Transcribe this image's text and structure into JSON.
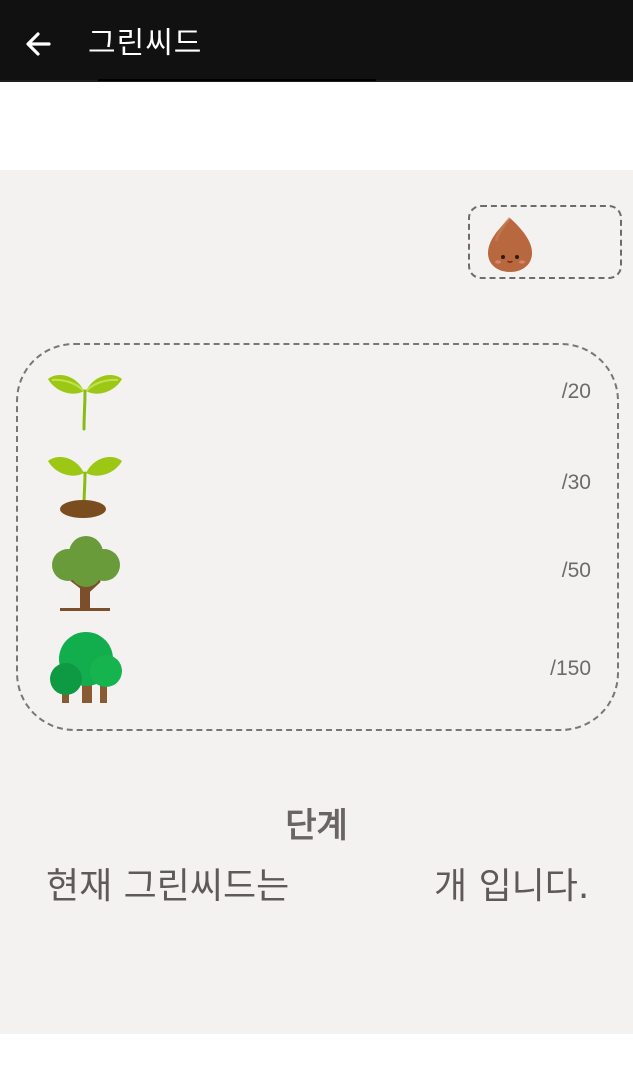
{
  "appbar": {
    "title": "그린씨드",
    "back_icon": "arrow-left-icon"
  },
  "seed": {
    "icon": "seed-character-icon"
  },
  "stages": [
    {
      "icon": "sprout-icon",
      "current": "",
      "max_label": "/20"
    },
    {
      "icon": "sprout-with-soil-icon",
      "current": "",
      "max_label": "/30"
    },
    {
      "icon": "tree-icon",
      "current": "",
      "max_label": "/50"
    },
    {
      "icon": "forest-icon",
      "current": "",
      "max_label": "/150"
    }
  ],
  "level": {
    "value": "",
    "suffix": "단계"
  },
  "status": {
    "prefix": "현재 그린씨드는",
    "count": "",
    "suffix": "개 입니다."
  },
  "colors": {
    "appbar_bg": "#111111",
    "content_bg": "#f4f2f0",
    "seed_brown": "#b8683e",
    "leaf_green": "#9cc815",
    "tree_green": "#6a9b3b",
    "forest_green": "#12ad4c"
  }
}
